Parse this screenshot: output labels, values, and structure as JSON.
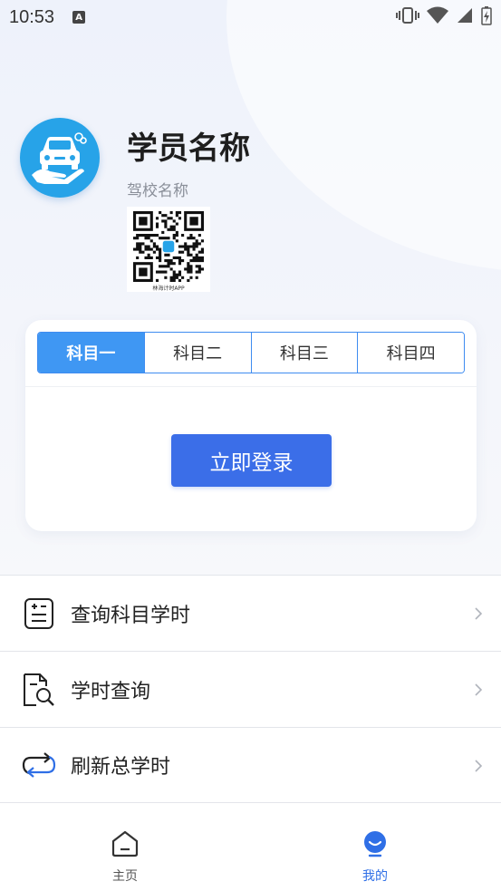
{
  "status_bar": {
    "time": "10:53",
    "badge": "A"
  },
  "profile": {
    "student_name": "学员名称",
    "school_name": "驾校名称",
    "qr_caption": "林海计时APP",
    "avatar_icon": "car-in-hand-icon",
    "avatar_color": "#27a3e8"
  },
  "subject_tabs": [
    {
      "label": "科目一",
      "active": true
    },
    {
      "label": "科目二",
      "active": false
    },
    {
      "label": "科目三",
      "active": false
    },
    {
      "label": "科目四",
      "active": false
    }
  ],
  "login_button": {
    "label": "立即登录",
    "color": "#3b6ee8"
  },
  "menu": [
    {
      "label": "查询科目学时",
      "icon": "calculator-icon"
    },
    {
      "label": "学时查询",
      "icon": "document-search-icon"
    },
    {
      "label": "刷新总学时",
      "icon": "refresh-icon"
    }
  ],
  "bottom_nav": [
    {
      "label": "主页",
      "icon": "home-icon",
      "active": false
    },
    {
      "label": "我的",
      "icon": "profile-smile-icon",
      "active": true
    }
  ],
  "colors": {
    "accent": "#3f97f3",
    "nav_active": "#2f6fe6"
  }
}
